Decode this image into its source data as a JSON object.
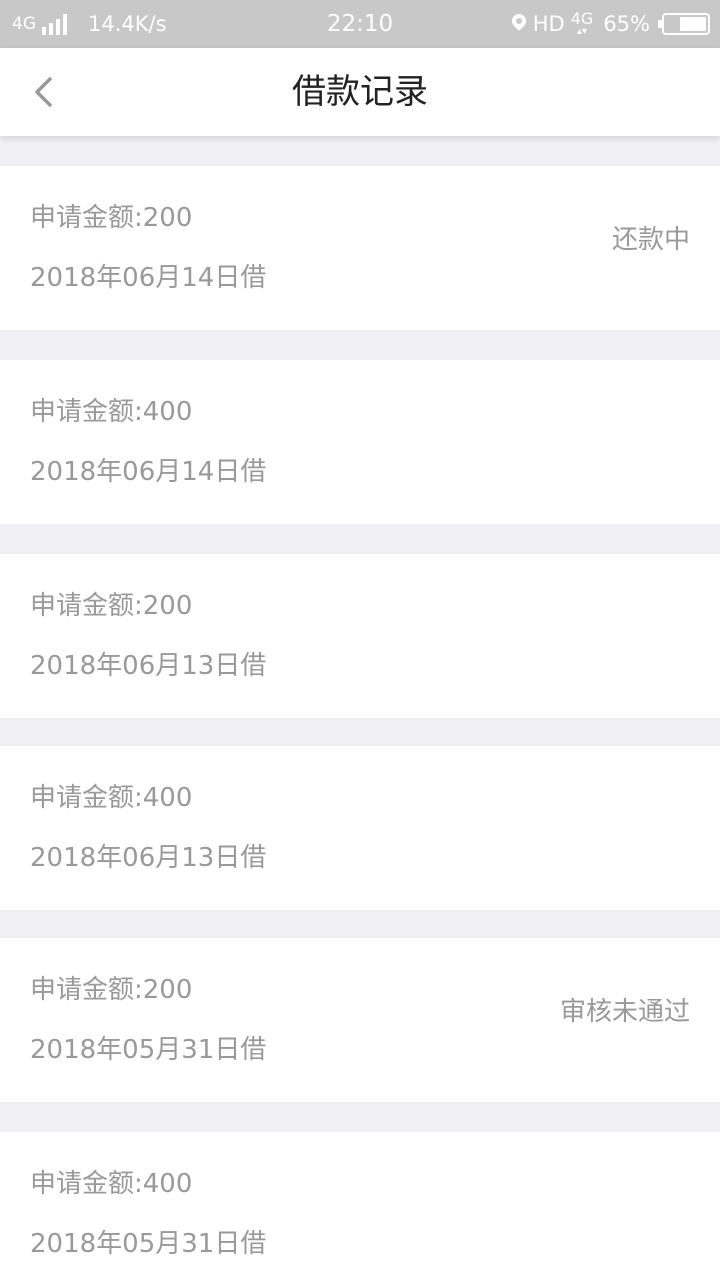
{
  "status_bar": {
    "network": "4G",
    "speed": "14.4K/s",
    "time": "22:10",
    "hd": "HD",
    "net_type": "4G",
    "battery_percent": "65%",
    "battery_level": 0.65
  },
  "header": {
    "title": "借款记录",
    "back_icon": "chevron-left-icon"
  },
  "records": [
    {
      "amount": "申请金额:200",
      "date": "2018年06月14日借",
      "status": "还款中"
    },
    {
      "amount": "申请金额:400",
      "date": "2018年06月14日借",
      "status": ""
    },
    {
      "amount": "申请金额:200",
      "date": "2018年06月13日借",
      "status": ""
    },
    {
      "amount": "申请金额:400",
      "date": "2018年06月13日借",
      "status": ""
    },
    {
      "amount": "申请金额:200",
      "date": "2018年05月31日借",
      "status": "审核未通过"
    },
    {
      "amount": "申请金额:400",
      "date": "2018年05月31日借",
      "status": ""
    }
  ],
  "colors": {
    "background": "#efeff4",
    "card": "#ffffff",
    "text_secondary": "#999999",
    "title": "#222222",
    "status_bar": "#c8c8c8"
  }
}
